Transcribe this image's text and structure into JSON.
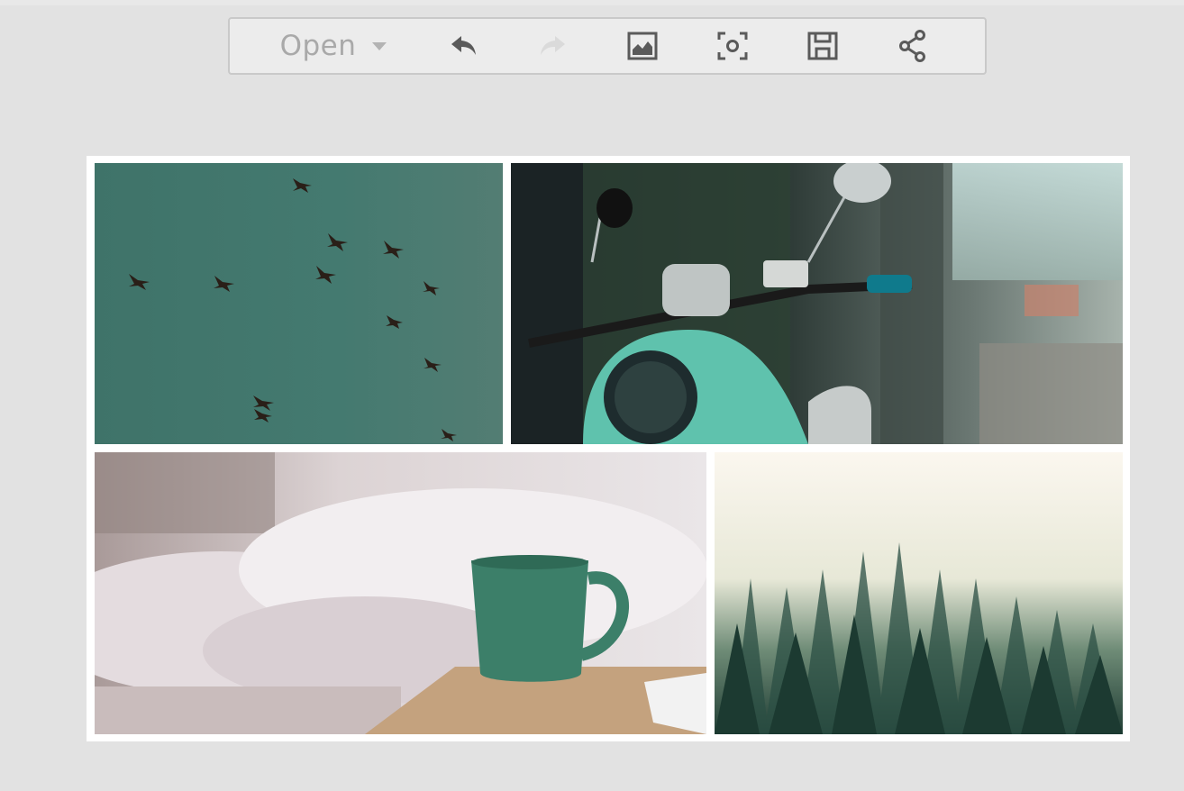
{
  "toolbar": {
    "open_label": "Open",
    "icons": [
      "chevron-down-icon",
      "undo-icon",
      "redo-icon",
      "image-icon",
      "focus-icon",
      "save-icon",
      "share-icon"
    ]
  },
  "collage": {
    "tiles": [
      "birds-in-sky",
      "teal-scooter",
      "mug-on-bedside-table",
      "misty-pine-forest"
    ]
  },
  "colors": {
    "background": "#e2e2e2",
    "toolbar_bg": "#ececec",
    "icon_active": "#5a5a5a",
    "icon_disabled": "#dadada",
    "text_muted": "#a9a9a9",
    "teal_accent": "#5fc2ad"
  }
}
